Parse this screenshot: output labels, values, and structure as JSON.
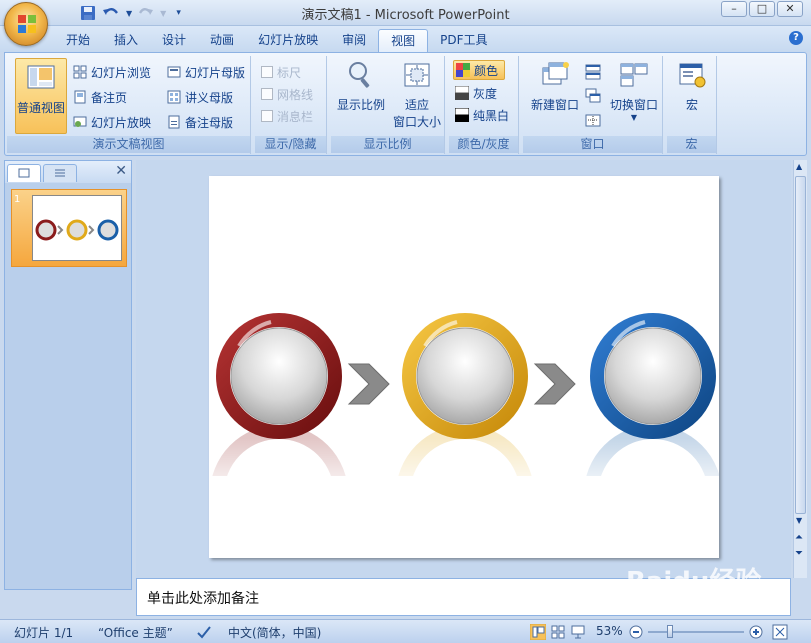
{
  "window": {
    "title": "演示文稿1 - Microsoft PowerPoint",
    "controls": [
      "–",
      "□",
      "✕"
    ]
  },
  "qat_icons": [
    "save-icon",
    "undo-icon",
    "redo-icon",
    "customize-icon"
  ],
  "tabs": [
    {
      "label": "开始"
    },
    {
      "label": "插入"
    },
    {
      "label": "设计"
    },
    {
      "label": "动画"
    },
    {
      "label": "幻灯片放映"
    },
    {
      "label": "审阅"
    },
    {
      "label": "视图",
      "active": true
    },
    {
      "label": "PDF工具"
    }
  ],
  "ribbon": {
    "presentation_views": {
      "label": "演示文稿视图",
      "normal": "普通视图",
      "slide_sorter": "幻灯片浏览",
      "notes_page": "备注页",
      "slide_show": "幻灯片放映",
      "slide_master": "幻灯片母版",
      "handout_master": "讲义母版",
      "notes_master": "备注母版"
    },
    "show_hide": {
      "label": "显示/隐藏",
      "ruler": "标尺",
      "gridlines": "网格线",
      "message_bar": "消息栏"
    },
    "zoom": {
      "label": "显示比例",
      "zoom": "显示比例",
      "fit_line1": "适应",
      "fit_line2": "窗口大小"
    },
    "color": {
      "label": "颜色/灰度",
      "color": "颜色",
      "grayscale": "灰度",
      "pure_bw": "纯黑白"
    },
    "window": {
      "label": "窗口",
      "new_window": "新建窗口",
      "switch_windows": "切换窗口"
    },
    "macros": {
      "label": "宏",
      "macros": "宏"
    }
  },
  "slide_panel": {
    "slide_number": "1"
  },
  "notes": {
    "placeholder": "单击此处添加备注"
  },
  "status": {
    "slide": "幻灯片 1/1",
    "theme": "“Office 主题”",
    "language": "中文(简体，中国)",
    "zoom": "53%"
  },
  "colors": {
    "accent": "#f5a73e",
    "ring_red": "#8b1c1c",
    "ring_gold": "#e0a91a",
    "ring_blue": "#1a5fa8"
  },
  "watermark": "Baidu经验 jingyan.baidu.com"
}
